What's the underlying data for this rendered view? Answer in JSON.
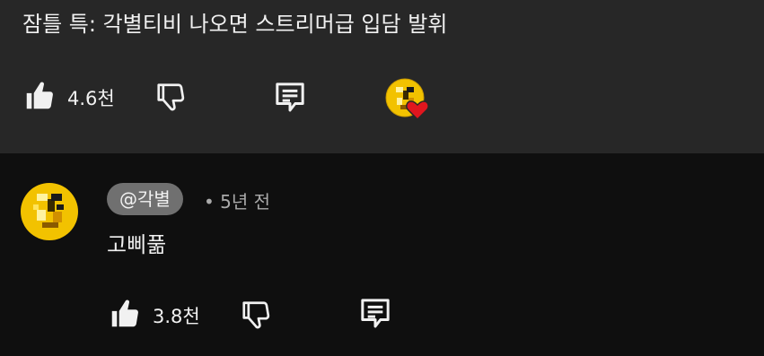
{
  "parent_comment": {
    "text": "잠틀 특: 각별티비 나오면 스트리머급 입담 발휘",
    "like_count": "4.6천",
    "icons": {
      "like": "thumbs-up-icon",
      "dislike": "thumbs-down-icon",
      "reply": "reply-comment-icon",
      "creator_heart": "creator-heart-badge"
    }
  },
  "reply": {
    "author": "@각별",
    "separator": "•",
    "time": "5년 전",
    "text": "고삐풂",
    "like_count": "3.8천"
  },
  "colors": {
    "parent_background": "#272727",
    "page_background": "#0f0f0f",
    "author_chip": "#707070",
    "heart": "#e0161e",
    "avatar_gold": "#f2c200"
  }
}
